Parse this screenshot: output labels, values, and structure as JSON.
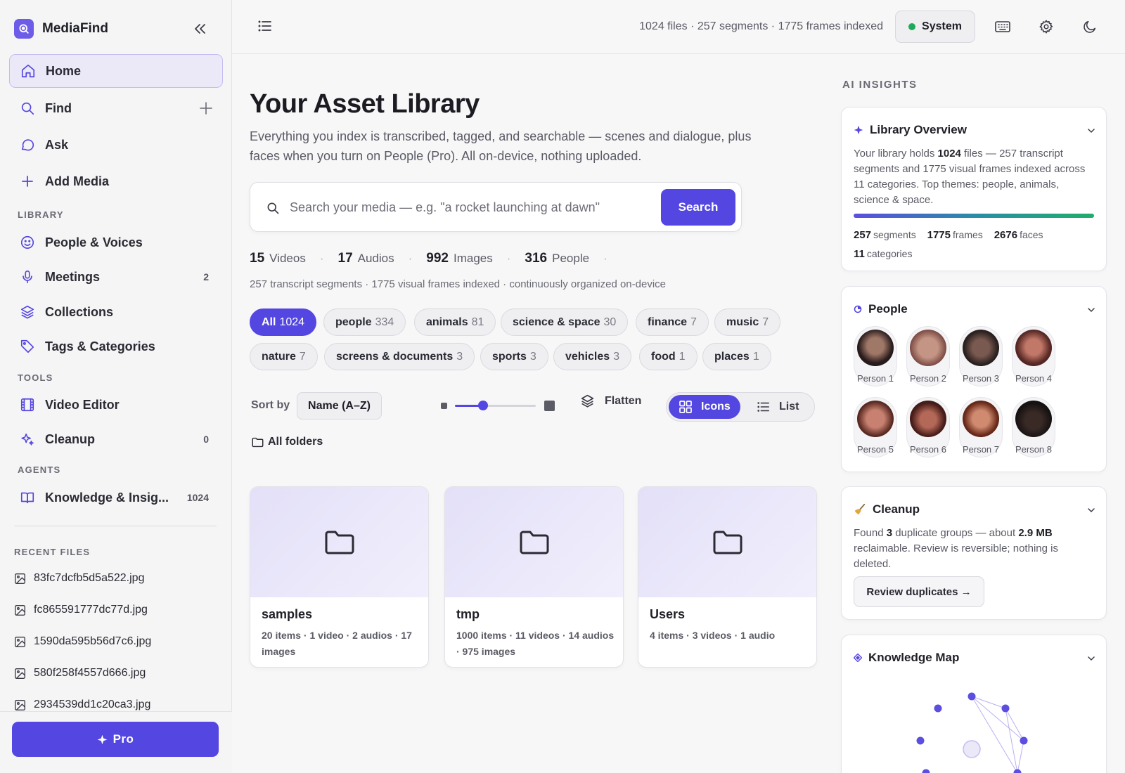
{
  "app": {
    "name": "MediaFind",
    "logo_icon": "search-icon",
    "accent": "#5446e0"
  },
  "sidebar": {
    "nav": [
      {
        "label": "Home",
        "icon": "home-icon",
        "active": true
      },
      {
        "label": "Find",
        "icon": "search-icon"
      },
      {
        "label": "Ask",
        "icon": "chat-icon"
      },
      {
        "label": "Add Media",
        "icon": "plus-icon"
      }
    ],
    "library_label": "LIBRARY",
    "library": [
      {
        "label": "People & Voices",
        "icon": "smile-icon"
      },
      {
        "label": "Meetings",
        "icon": "mic-icon",
        "badge": "2"
      },
      {
        "label": "Collections",
        "icon": "layers-icon"
      },
      {
        "label": "Tags & Categories",
        "icon": "tag-icon"
      }
    ],
    "tools_label": "TOOLS",
    "tools": [
      {
        "label": "Video Editor",
        "icon": "film-icon"
      },
      {
        "label": "Cleanup",
        "icon": "sparkles-icon",
        "badge": "0"
      }
    ],
    "agents_label": "AGENTS",
    "agents": [
      {
        "label": "Knowledge & Insig...",
        "icon": "book-icon",
        "badge": "1024"
      }
    ],
    "recent_label": "RECENT FILES",
    "recent": [
      "83fc7dcfb5d5a522.jpg",
      "fc865591777dc77d.jpg",
      "1590da595b56d7c6.jpg",
      "580f258f4557d666.jpg",
      "2934539dd1c20ca3.jpg"
    ],
    "pro_label": "Pro"
  },
  "topbar": {
    "index_status": "1024 files · 257 segments · 1775 frames indexed",
    "system_label": "System",
    "system_status_color": "#1eaa5b"
  },
  "main": {
    "title": "Your Asset Library",
    "subtitle": "Everything you index is transcribed, tagged, and searchable — scenes and dialogue, plus faces when you turn on People (Pro). All on-device, nothing uploaded.",
    "search_placeholder": "Search your media — e.g. \"a rocket launching at dawn\"",
    "search_button": "Search",
    "stats": [
      {
        "value": "15",
        "label": "Videos"
      },
      {
        "value": "17",
        "label": "Audios"
      },
      {
        "value": "992",
        "label": "Images"
      },
      {
        "value": "316",
        "label": "People"
      }
    ],
    "stats_sub": "257 transcript segments · 1775 visual frames indexed · continuously organized on-device",
    "chips": [
      {
        "label": "All",
        "count": "1024",
        "active": true
      },
      {
        "label": "people",
        "count": "334"
      },
      {
        "label": "animals",
        "count": "81"
      },
      {
        "label": "science & space",
        "count": "30"
      },
      {
        "label": "finance",
        "count": "7"
      },
      {
        "label": "music",
        "count": "7"
      },
      {
        "label": "nature",
        "count": "7"
      },
      {
        "label": "screens & documents",
        "count": "3"
      },
      {
        "label": "sports",
        "count": "3"
      },
      {
        "label": "vehicles",
        "count": "3"
      },
      {
        "label": "food",
        "count": "1"
      },
      {
        "label": "places",
        "count": "1"
      }
    ],
    "sort_label": "Sort by",
    "sort_value": "Name (A–Z)",
    "zoom_level": 0.35,
    "flatten_label": "Flatten",
    "view_icons": "Icons",
    "view_list": "List",
    "breadcrumb": "All folders",
    "folders": [
      {
        "name": "samples",
        "meta": "20 items · 1 video · 2 audios · 17 images"
      },
      {
        "name": "tmp",
        "meta": "1000 items · 11 videos · 14 audios · 975 images"
      },
      {
        "name": "Users",
        "meta": "4 items · 3 videos · 1 audio"
      }
    ]
  },
  "insights": {
    "title": "AI INSIGHTS",
    "overview": {
      "title": "Library Overview",
      "text_a": "Your library holds ",
      "files": "1024",
      "text_b": " files — 257 transcript segments and 1775 visual frames indexed across 11 categories. Top themes: people, animals, science & space.",
      "stats": [
        {
          "value": "257",
          "label": "segments"
        },
        {
          "value": "1775",
          "label": "frames"
        },
        {
          "value": "2676",
          "label": "faces"
        },
        {
          "value": "11",
          "label": "categories"
        }
      ]
    },
    "people": {
      "title": "People",
      "persons": [
        "Person 1",
        "Person 2",
        "Person 3",
        "Person 4",
        "Person 5",
        "Person 6",
        "Person 7",
        "Person 8"
      ]
    },
    "cleanup": {
      "title": "Cleanup",
      "text_a": "Found ",
      "groups": "3",
      "text_b": " duplicate groups — about ",
      "size": "2.9 MB",
      "text_c": " reclaimable. Review is reversible; nothing is deleted.",
      "button": "Review duplicates →"
    },
    "knowledge_map": {
      "title": "Knowledge Map"
    }
  }
}
